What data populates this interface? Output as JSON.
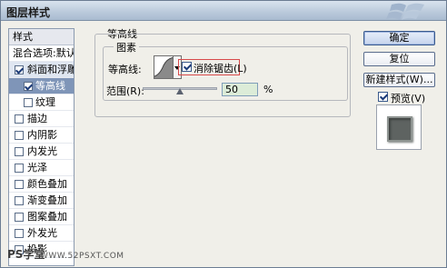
{
  "window": {
    "title": "图层样式"
  },
  "styles_panel": {
    "header": "样式",
    "items": [
      {
        "label": "混合选项:默认",
        "checkbox": false,
        "checked": false,
        "level": 0,
        "state": "normal"
      },
      {
        "label": "斜面和浮雕",
        "checkbox": true,
        "checked": true,
        "level": 0,
        "state": "selected"
      },
      {
        "label": "等高线",
        "checkbox": true,
        "checked": true,
        "level": 1,
        "state": "highlight"
      },
      {
        "label": "纹理",
        "checkbox": true,
        "checked": false,
        "level": 1,
        "state": "normal"
      },
      {
        "label": "描边",
        "checkbox": true,
        "checked": false,
        "level": 0,
        "state": "normal"
      },
      {
        "label": "内阴影",
        "checkbox": true,
        "checked": false,
        "level": 0,
        "state": "normal"
      },
      {
        "label": "内发光",
        "checkbox": true,
        "checked": false,
        "level": 0,
        "state": "normal"
      },
      {
        "label": "光泽",
        "checkbox": true,
        "checked": false,
        "level": 0,
        "state": "normal"
      },
      {
        "label": "颜色叠加",
        "checkbox": true,
        "checked": false,
        "level": 0,
        "state": "normal"
      },
      {
        "label": "渐变叠加",
        "checkbox": true,
        "checked": false,
        "level": 0,
        "state": "normal"
      },
      {
        "label": "图案叠加",
        "checkbox": true,
        "checked": false,
        "level": 0,
        "state": "normal"
      },
      {
        "label": "外发光",
        "checkbox": true,
        "checked": false,
        "level": 0,
        "state": "normal"
      },
      {
        "label": "投影",
        "checkbox": true,
        "checked": false,
        "level": 0,
        "state": "normal"
      }
    ]
  },
  "contour_section": {
    "title": "等高线",
    "group_title": "图素",
    "contour_label": "等高线:",
    "anti_alias_label": "消除锯齿(L)",
    "anti_alias_checked": true,
    "range_label": "范围(R):",
    "range_value": "50",
    "range_unit": "%",
    "range_slider_fraction": 0.5
  },
  "buttons": {
    "ok": "确定",
    "reset": "复位",
    "new_style": "新建样式(W)...",
    "preview_label": "预览(V)",
    "preview_checked": true
  },
  "watermark": {
    "text": "PS学堂",
    "url": "WWW.52PSXT.COM"
  },
  "colors": {
    "highlight_row": "#7f95b8",
    "anti_alias_outline": "#d84a4a",
    "range_input_bg": "#dcecd8"
  }
}
